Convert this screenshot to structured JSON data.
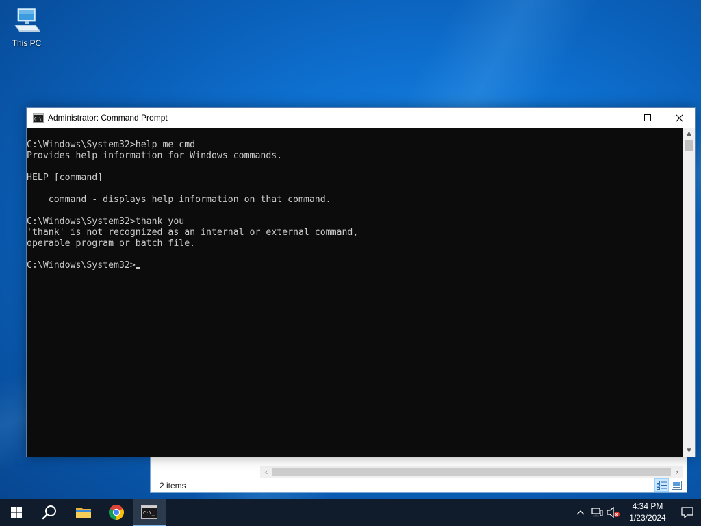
{
  "desktop": {
    "icons": [
      {
        "label": "This PC",
        "icon": "this-pc-icon"
      }
    ]
  },
  "explorer": {
    "status_text": "2 items",
    "scroll_left": "‹",
    "scroll_right": "›",
    "views": [
      "details-view-icon",
      "large-icons-view-icon"
    ]
  },
  "cmd": {
    "title": "Administrator: Command Prompt",
    "icon": "command-prompt-icon",
    "controls": [
      "minimize-icon",
      "maximize-icon",
      "close-icon"
    ],
    "lines": [
      "C:\\Windows\\System32>help me cmd",
      "Provides help information for Windows commands.",
      "",
      "HELP [command]",
      "",
      "    command - displays help information on that command.",
      "",
      "C:\\Windows\\System32>thank you",
      "'thank' is not recognized as an internal or external command,",
      "operable program or batch file.",
      "",
      "C:\\Windows\\System32>"
    ],
    "scroll_up": "▲",
    "scroll_down": "▼"
  },
  "taskbar": {
    "pinned": [
      {
        "name": "start",
        "icon": "windows-start-icon"
      },
      {
        "name": "search",
        "icon": "search-icon"
      },
      {
        "name": "file-explorer",
        "icon": "folder-icon"
      },
      {
        "name": "chrome",
        "icon": "chrome-icon"
      },
      {
        "name": "command-prompt",
        "icon": "command-prompt-icon",
        "active": true
      }
    ],
    "tray": {
      "icons": [
        "chevron-up-icon",
        "network-icon",
        "volume-muted-icon"
      ],
      "time": "4:34 PM",
      "date": "1/23/2024",
      "notification_icon": "action-center-icon"
    }
  },
  "colors": {
    "taskbar": "#101c2c",
    "console_bg": "#0c0c0c",
    "console_text": "#cccccc",
    "accent": "#7cb6f0"
  }
}
